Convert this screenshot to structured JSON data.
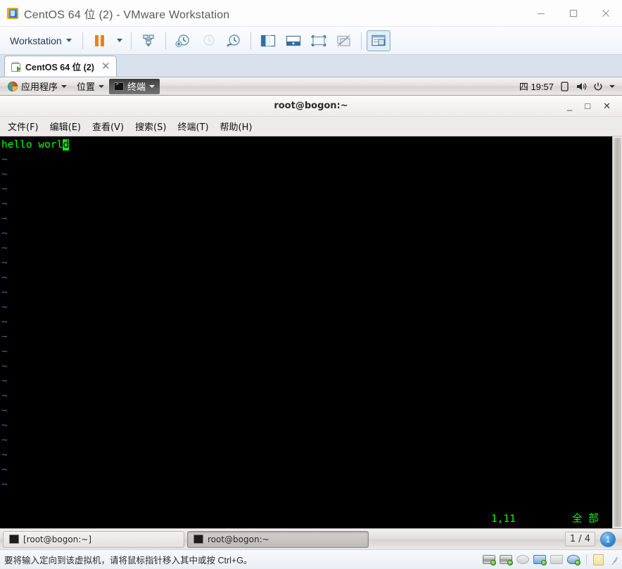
{
  "window": {
    "title": "CentOS 64 位 (2) - VMware Workstation",
    "icon": "vmware-logo-icon",
    "controls": {
      "minimize": "–",
      "maximize": "□",
      "close": "✕"
    }
  },
  "toolbar": {
    "workstation_label": "Workstation",
    "items": [
      {
        "name": "workstation-menu",
        "label": "Workstation",
        "icon": "chevron-down-icon"
      },
      {
        "name": "suspend-button",
        "label": "",
        "icon": "pause-icon"
      },
      {
        "name": "power-dropdown",
        "label": "",
        "icon": "chevron-down-icon"
      },
      {
        "name": "send-ctrl-alt-del-button",
        "label": "",
        "icon": "keyboard-send-icon"
      },
      {
        "name": "take-snapshot-button",
        "label": "",
        "icon": "snapshot-add-icon"
      },
      {
        "name": "revert-snapshot-button",
        "label": "",
        "icon": "snapshot-revert-icon"
      },
      {
        "name": "manage-snapshots-button",
        "label": "",
        "icon": "snapshot-manage-icon"
      },
      {
        "name": "show-library-button",
        "label": "",
        "icon": "library-panel-icon"
      },
      {
        "name": "show-thumbnail-bar-button",
        "label": "",
        "icon": "thumbnail-bar-icon"
      },
      {
        "name": "enter-fullscreen-button",
        "label": "",
        "icon": "fullscreen-icon"
      },
      {
        "name": "unity-mode-button",
        "label": "",
        "icon": "unity-disabled-icon"
      },
      {
        "name": "console-view-button",
        "label": "",
        "icon": "console-view-icon"
      }
    ]
  },
  "vm_tab": {
    "label": "CentOS 64 位 (2)",
    "close_label": "✕",
    "icon": "vm-running-icon"
  },
  "guest": {
    "gnome_panel": {
      "applications": "应用程序",
      "places": "位置",
      "terminal": "终端",
      "clock": "四 19:57",
      "icons": [
        "display-icon",
        "volume-icon",
        "power-icon",
        "chevron-down-icon"
      ]
    },
    "terminal_window": {
      "title": "root@bogon:~",
      "menu": [
        "文件(F)",
        "编辑(E)",
        "查看(V)",
        "搜索(S)",
        "终端(T)",
        "帮助(H)"
      ],
      "window_buttons": {
        "minimize": "_",
        "maximize": "□",
        "close": "✕"
      },
      "editor": {
        "first_line_text": "hello worl",
        "cursor_char": "d",
        "tilde_marker": "~",
        "tilde_line_count": 23,
        "status_position": "1,11",
        "status_scroll": "全 部"
      }
    },
    "taskbar": {
      "windows": [
        {
          "label": "[root@bogon:~]",
          "active": false,
          "icon": "terminal-icon"
        },
        {
          "label": "root@bogon:~",
          "active": true,
          "icon": "terminal-icon"
        }
      ],
      "workspace_label": "1 / 4",
      "workspace_badge": "1"
    }
  },
  "status_bar": {
    "message": "要将输入定向到该虚拟机，请将鼠标指针移入其中或按 Ctrl+G。",
    "devices": [
      {
        "name": "hard-disk-1-icon",
        "connected": true
      },
      {
        "name": "hard-disk-2-icon",
        "connected": true
      },
      {
        "name": "cd-dvd-icon",
        "connected": false
      },
      {
        "name": "network-adapter-icon",
        "connected": true
      },
      {
        "name": "printer-icon",
        "connected": false
      },
      {
        "name": "usb-controller-icon",
        "connected": true
      },
      {
        "name": "notes-icon",
        "connected": false
      }
    ]
  },
  "colors": {
    "terminal_bg": "#000000",
    "terminal_fg": "#00ff00",
    "tilde_fg": "#4b6b8a",
    "accent": "#3a8fd4",
    "toolbar_orange": "#e8821e"
  }
}
